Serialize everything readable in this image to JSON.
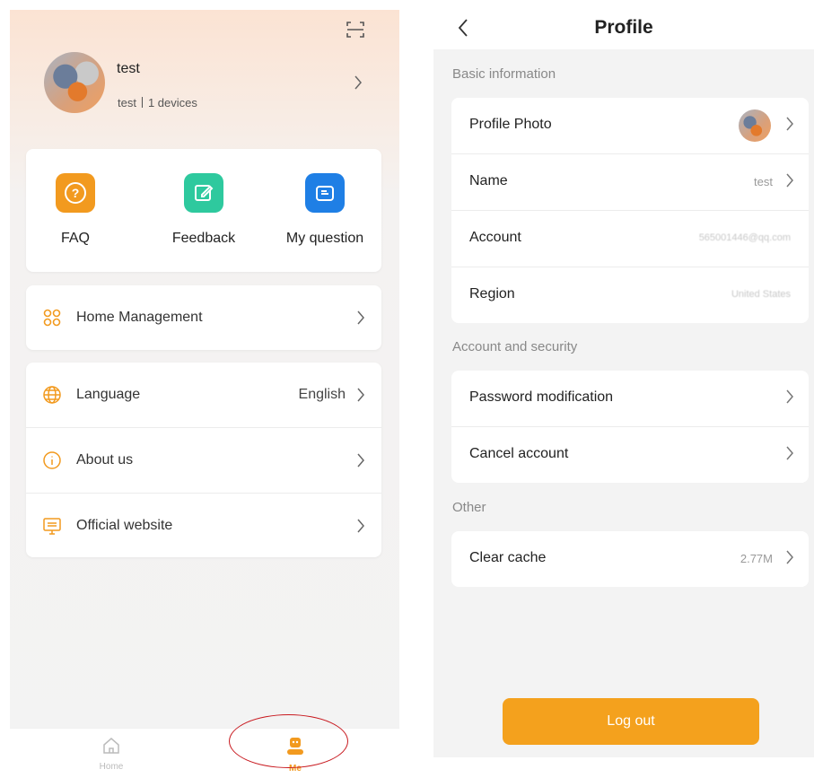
{
  "me_page": {
    "user": {
      "name": "test",
      "subtitle": "test丨1 devices"
    },
    "quick_actions": [
      {
        "label": "FAQ",
        "icon": "question-icon",
        "color": "#f29a1f"
      },
      {
        "label": "Feedback",
        "icon": "edit-icon",
        "color": "#2ec99e"
      },
      {
        "label": "My question",
        "icon": "mail-icon",
        "color": "#1f7fe5"
      }
    ],
    "home_management": {
      "label": "Home Management",
      "icon": "grid-icon"
    },
    "settings": [
      {
        "label": "Language",
        "value": "English",
        "icon": "globe-icon"
      },
      {
        "label": "About us",
        "value": "",
        "icon": "info-icon"
      },
      {
        "label": "Official website",
        "value": "",
        "icon": "monitor-icon"
      }
    ],
    "tabbar": {
      "home": "Home",
      "me": "Me"
    },
    "accent": "#f29a1f"
  },
  "profile_page": {
    "title": "Profile",
    "sections": {
      "basic": "Basic information",
      "security": "Account and security",
      "other": "Other"
    },
    "basic_rows": [
      {
        "label": "Profile Photo",
        "value": ""
      },
      {
        "label": "Name",
        "value": "test"
      },
      {
        "label": "Account",
        "value": "565001446@qq.com"
      },
      {
        "label": "Region",
        "value": "United States"
      }
    ],
    "security_rows": [
      {
        "label": "Password modification"
      },
      {
        "label": "Cancel account"
      }
    ],
    "other_rows": [
      {
        "label": "Clear cache",
        "value": "2.77M"
      }
    ],
    "logout": "Log out"
  }
}
